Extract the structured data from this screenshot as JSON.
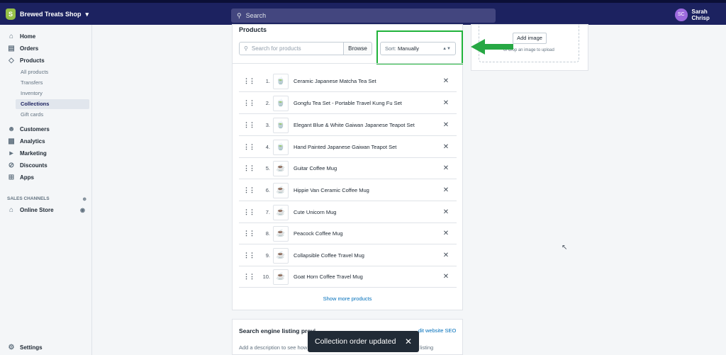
{
  "topbar": {
    "shop_name": "Brewed Treats Shop",
    "shop_logo": "S",
    "search_placeholder": "Search",
    "user_initials": "SC",
    "user_name": "Sarah Chrisp"
  },
  "sidebar": {
    "nav": [
      {
        "label": "Home",
        "icon": "home-icon"
      },
      {
        "label": "Orders",
        "icon": "orders-icon"
      },
      {
        "label": "Products",
        "icon": "tag-icon"
      },
      {
        "label": "Customers",
        "icon": "person-icon"
      },
      {
        "label": "Analytics",
        "icon": "chart-icon"
      },
      {
        "label": "Marketing",
        "icon": "megaphone-icon"
      },
      {
        "label": "Discounts",
        "icon": "discount-icon"
      },
      {
        "label": "Apps",
        "icon": "apps-icon"
      }
    ],
    "product_sub": [
      "All products",
      "Transfers",
      "Inventory",
      "Collections",
      "Gift cards"
    ],
    "sales_channels_label": "SALES CHANNELS",
    "online_store": "Online Store",
    "settings": "Settings"
  },
  "products": {
    "title": "Products",
    "search_placeholder": "Search for products",
    "browse_label": "Browse",
    "sort_label": "Sort:",
    "sort_value": "Manually",
    "items": [
      {
        "num": "1.",
        "name": "Ceramic Japanese Matcha Tea Set"
      },
      {
        "num": "2.",
        "name": "Gongfu Tea Set - Portable Travel Kung Fu Set"
      },
      {
        "num": "3.",
        "name": "Elegant Blue & White Gaiwan Japanese Teapot Set"
      },
      {
        "num": "4.",
        "name": "Hand Painted Japanese Gaiwan Teapot Set"
      },
      {
        "num": "5.",
        "name": "Guitar Coffee Mug"
      },
      {
        "num": "6.",
        "name": "Hippie Van Ceramic Coffee Mug"
      },
      {
        "num": "7.",
        "name": "Cute Unicorn Mug"
      },
      {
        "num": "8.",
        "name": "Peacock Coffee Mug"
      },
      {
        "num": "9.",
        "name": "Collapsible Coffee Travel Mug"
      },
      {
        "num": "10.",
        "name": "Goat Horn Coffee Travel Mug"
      }
    ],
    "show_more": "Show more products"
  },
  "image_panel": {
    "add_image": "Add image",
    "drop_text": "or drop an image to upload"
  },
  "seo": {
    "title": "Search engine listing previ",
    "edit_link": "dit website SEO",
    "description": "Add a description to see how",
    "description_tail": "listing"
  },
  "toast": {
    "message": "Collection order updated"
  },
  "colors": {
    "topbar": "#1c2260",
    "highlight": "#20b33a",
    "arrow": "#27a844",
    "link": "#006fbb"
  }
}
